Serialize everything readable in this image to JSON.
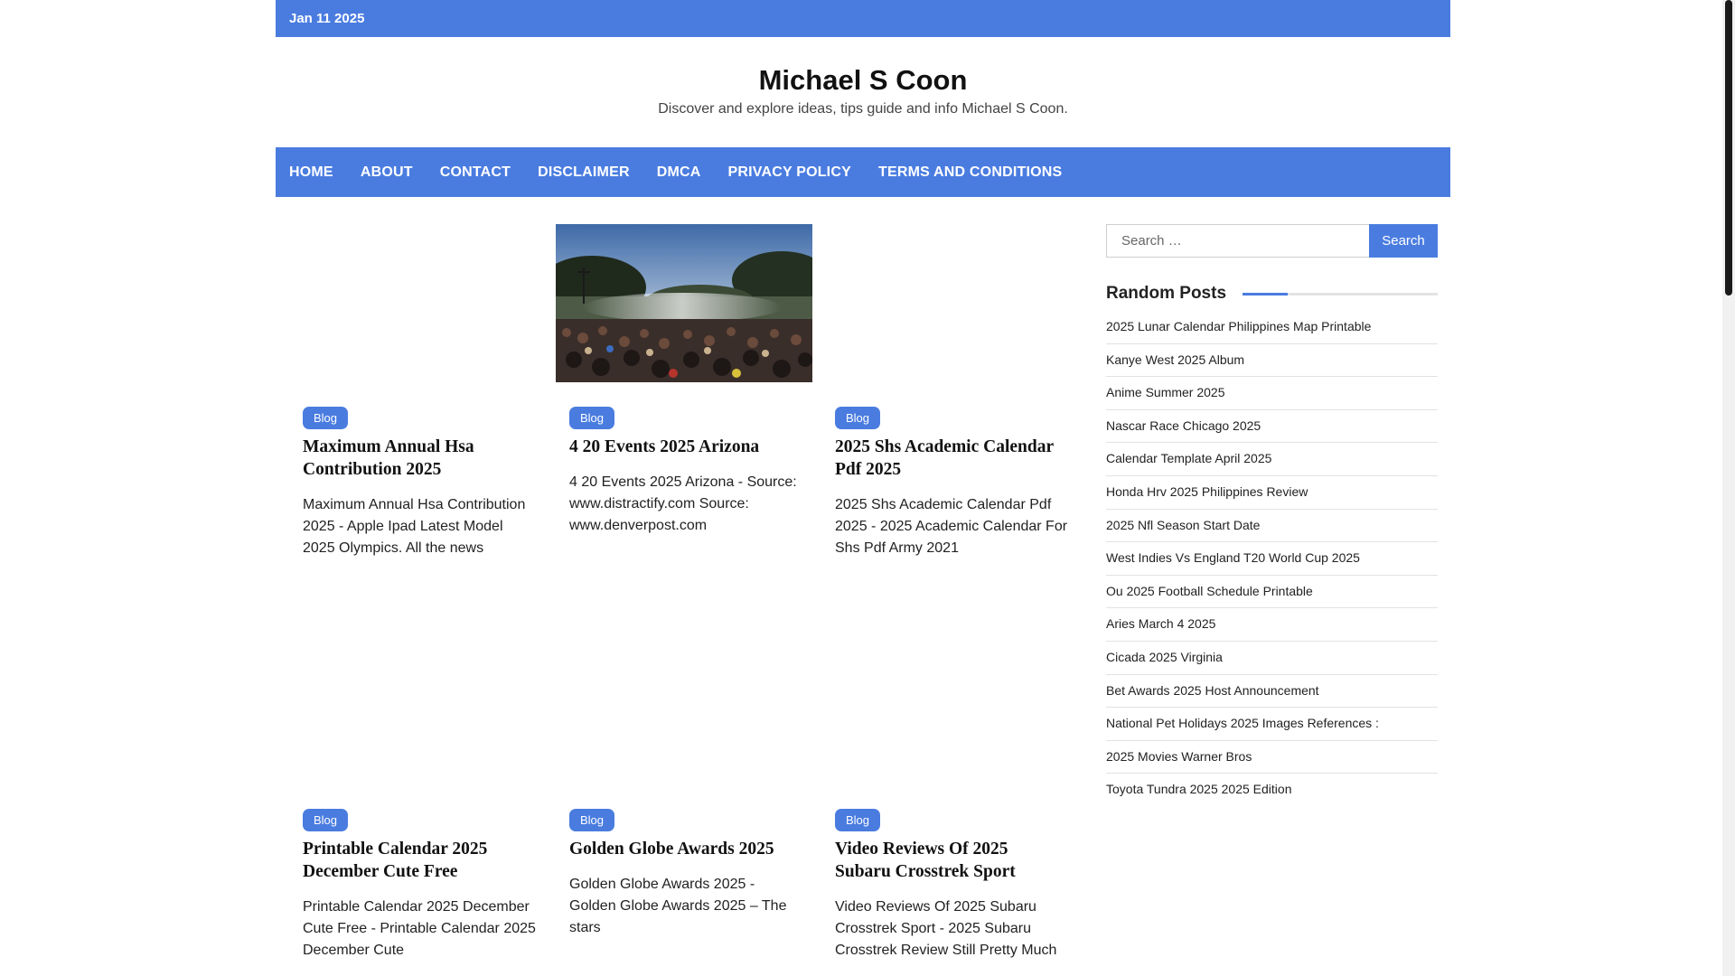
{
  "topbar": {
    "date": "Jan 11 2025"
  },
  "header": {
    "title": "Michael S Coon",
    "description": "Discover and explore ideas, tips guide and info Michael S Coon."
  },
  "nav": {
    "items": [
      "HOME",
      "ABOUT",
      "CONTACT",
      "DISCLAIMER",
      "DMCA",
      "PRIVACY POLICY",
      "TERMS AND CONDITIONS"
    ]
  },
  "posts": [
    {
      "category": "Blog",
      "title": "Maximum Annual Hsa Contribution 2025",
      "excerpt": "Maximum Annual Hsa Contribution 2025 - Apple Ipad Latest Model 2025 Olympics. All the news",
      "has_image": false
    },
    {
      "category": "Blog",
      "title": "4 20 Events 2025 Arizona",
      "excerpt": "4 20 Events 2025 Arizona - Source: www.distractify.com Source: www.denverpost.com",
      "has_image": true
    },
    {
      "category": "Blog",
      "title": "2025 Shs Academic Calendar Pdf 2025",
      "excerpt": "2025 Shs Academic Calendar Pdf 2025 - 2025 Academic Calendar For Shs Pdf Army 2021",
      "has_image": false
    },
    {
      "category": "Blog",
      "title": "Printable Calendar 2025 December Cute Free",
      "excerpt": "Printable Calendar 2025 December Cute Free - Printable Calendar 2025 December Cute",
      "has_image": false
    },
    {
      "category": "Blog",
      "title": "Golden Globe Awards 2025",
      "excerpt": "Golden Globe Awards 2025 - Golden Globe Awards 2025 – The stars",
      "has_image": false
    },
    {
      "category": "Blog",
      "title": "Video Reviews Of 2025 Subaru Crosstrek Sport",
      "excerpt": "Video Reviews Of 2025 Subaru Crosstrek Sport - 2025 Subaru Crosstrek Review Still Pretty Much",
      "has_image": false
    }
  ],
  "sidebar": {
    "search_placeholder": "Search …",
    "search_button": "Search",
    "widget_title": "Random Posts",
    "random_posts": [
      "2025 Lunar Calendar Philippines Map Printable",
      "Kanye West 2025 Album",
      "Anime Summer 2025",
      "Nascar Race Chicago 2025",
      "Calendar Template April 2025",
      "Honda Hrv 2025 Philippines Review",
      "2025 Nfl Season Start Date",
      "West Indies Vs England T20 World Cup 2025",
      "Ou 2025 Football Schedule Printable",
      "Aries March 4 2025",
      "Cicada 2025 Virginia",
      "Bet Awards 2025 Host Announcement",
      "National Pet Holidays 2025 Images References :",
      "2025 Movies Warner Bros",
      "Toyota Tundra 2025 2025 Edition"
    ]
  },
  "colors": {
    "accent": "#4a7ce0"
  }
}
